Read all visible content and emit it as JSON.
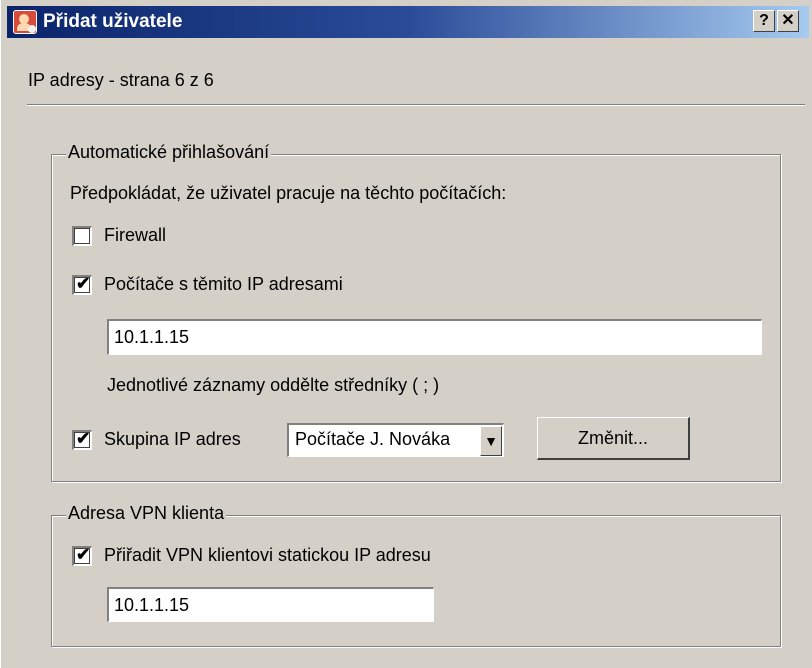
{
  "window": {
    "title": "Přidat uživatele",
    "help_label": "?",
    "close_label": "✕"
  },
  "page": {
    "title": "IP adresy - strana 6 z 6"
  },
  "auto_login": {
    "legend": "Automatické přihlašování",
    "intro": "Předpokládat, že uživatel pracuje na těchto počítačích:",
    "firewall": {
      "label": "Firewall",
      "checked": false
    },
    "ip_computers": {
      "label": "Počítače s těmito IP adresami",
      "checked": true
    },
    "ip_value": "10.1.1.15",
    "hint": "Jednotlivé záznamy oddělte středníky ( ; )",
    "ip_group": {
      "label": "Skupina IP adres",
      "checked": true,
      "selected": "Počítače J. Nováka"
    },
    "change_button": "Změnit..."
  },
  "vpn": {
    "legend": "Adresa VPN klienta",
    "static_ip": {
      "label": "Přiřadit VPN klientovi statickou IP adresu",
      "checked": true
    },
    "ip_value": "10.1.1.15"
  },
  "check_glyph": "✔",
  "dropdown_glyph": "▼",
  "icons": [
    "add-user-icon",
    "help-icon",
    "close-icon",
    "chevron-down-icon"
  ]
}
